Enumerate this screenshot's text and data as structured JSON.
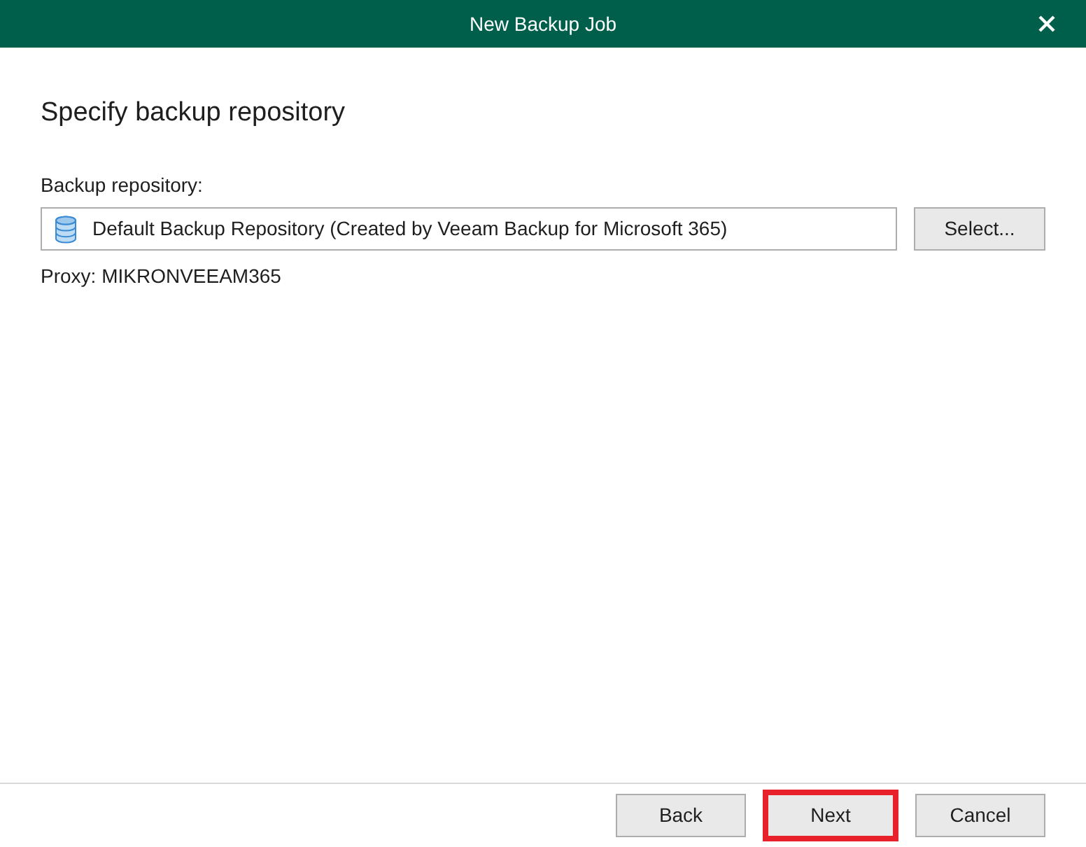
{
  "window": {
    "title": "New Backup Job"
  },
  "page": {
    "heading": "Specify backup repository"
  },
  "repository": {
    "label": "Backup repository:",
    "value": "Default Backup Repository (Created by Veeam Backup for Microsoft 365)",
    "select_button": "Select...",
    "proxy": "Proxy: MIKRONVEEAM365"
  },
  "buttons": [
    {
      "label": "Back",
      "highlighted": false
    },
    {
      "label": "Next",
      "highlighted": true
    },
    {
      "label": "Cancel",
      "highlighted": false
    }
  ]
}
